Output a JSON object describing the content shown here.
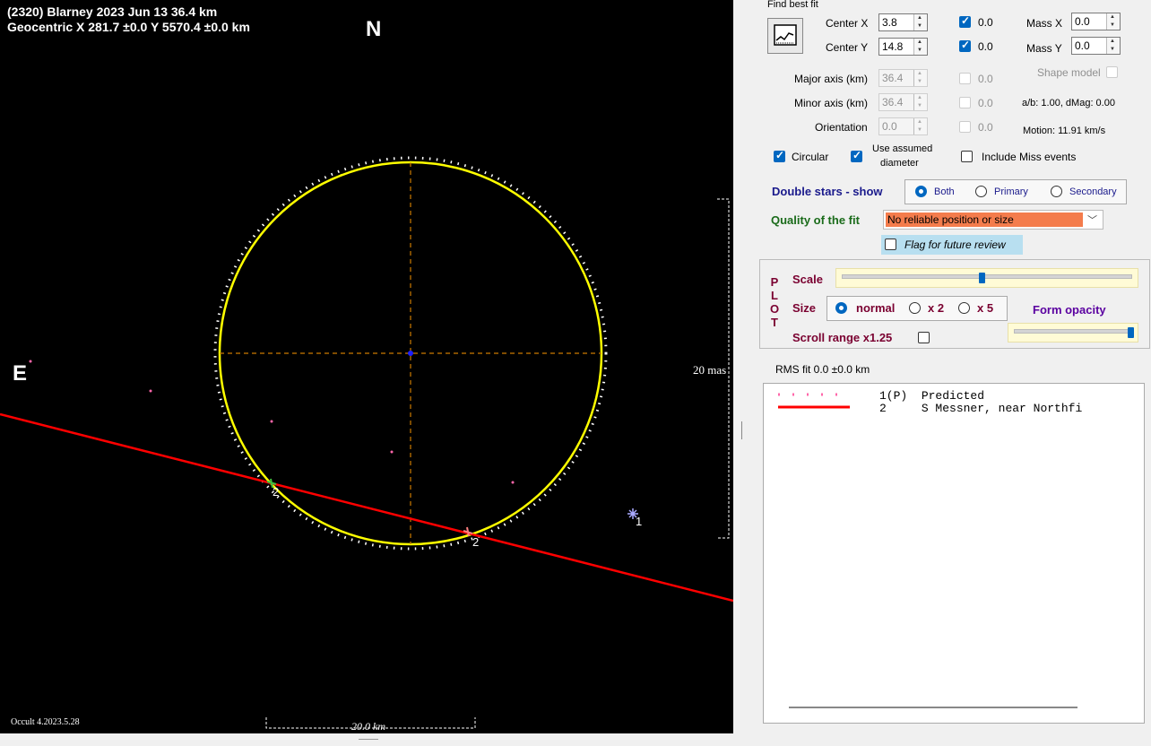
{
  "plot": {
    "title_line1": "(2320) Blarney  2023 Jun 13   36.4 km",
    "title_line2": "Geocentric  X  281.7 ±0.0  Y 5570.4 ±0.0 km",
    "north_label": "N",
    "east_label": "E",
    "scale_mas_label": "20 mas",
    "scale_km_label": "20.0 km",
    "version_label": "Occult 4.2023.5.28",
    "chord_labels": [
      "2",
      "2",
      "1"
    ],
    "colors": {
      "background": "#000000",
      "ellipse": "#ffff00",
      "chord": "#ff0000",
      "axes": "#cc7a00",
      "predicted_dots": "#ffffff"
    }
  },
  "find_best_fit": {
    "group_label": "Find best fit",
    "icon": "best-fit-chart-icon",
    "center_x": {
      "label": "Center X",
      "value": "3.8",
      "chk_value": "0.0",
      "checked": true
    },
    "center_y": {
      "label": "Center Y",
      "value": "14.8",
      "chk_value": "0.0",
      "checked": true
    },
    "mass_x": {
      "label": "Mass X",
      "value": "0.0"
    },
    "mass_y": {
      "label": "Mass Y",
      "value": "0.0"
    },
    "major_axis": {
      "label": "Major axis (km)",
      "value": "36.4",
      "chk_value": "0.0"
    },
    "minor_axis": {
      "label": "Minor axis (km)",
      "value": "36.4",
      "chk_value": "0.0"
    },
    "orientation": {
      "label": "Orientation",
      "value": "0.0",
      "chk_value": "0.0"
    },
    "shape_model_label": "Shape model",
    "ab_dmag": "a/b: 1.00, dMag: 0.00",
    "motion": "Motion: 11.91 km/s",
    "circular_label": "Circular",
    "use_assumed_line1": "Use assumed",
    "use_assumed_line2": "diameter",
    "include_miss_label": "Include Miss events"
  },
  "double_stars": {
    "label": "Double stars - show",
    "options": [
      "Both",
      "Primary",
      "Secondary"
    ],
    "selected": "Both"
  },
  "quality": {
    "label": "Quality of the fit",
    "value": "No reliable position or size",
    "flag_label": "Flag for future review"
  },
  "plot_settings": {
    "letters": [
      "P",
      "L",
      "O",
      "T"
    ],
    "scale_label": "Scale",
    "size_label": "Size",
    "size_options": [
      "normal",
      "x 2",
      "x 5"
    ],
    "size_selected": "normal",
    "form_opacity_label": "Form opacity",
    "scroll_range_label": "Scroll range x1.25",
    "scale_level": 0.48,
    "opacity_level": 1.0
  },
  "rms_fit": "RMS fit 0.0 ±0.0 km",
  "legend": [
    {
      "id": "1(P)",
      "name": "Predicted",
      "style": "dotted-pink"
    },
    {
      "id": "2",
      "name": "S Messner, near Northfi",
      "style": "solid-red"
    }
  ]
}
